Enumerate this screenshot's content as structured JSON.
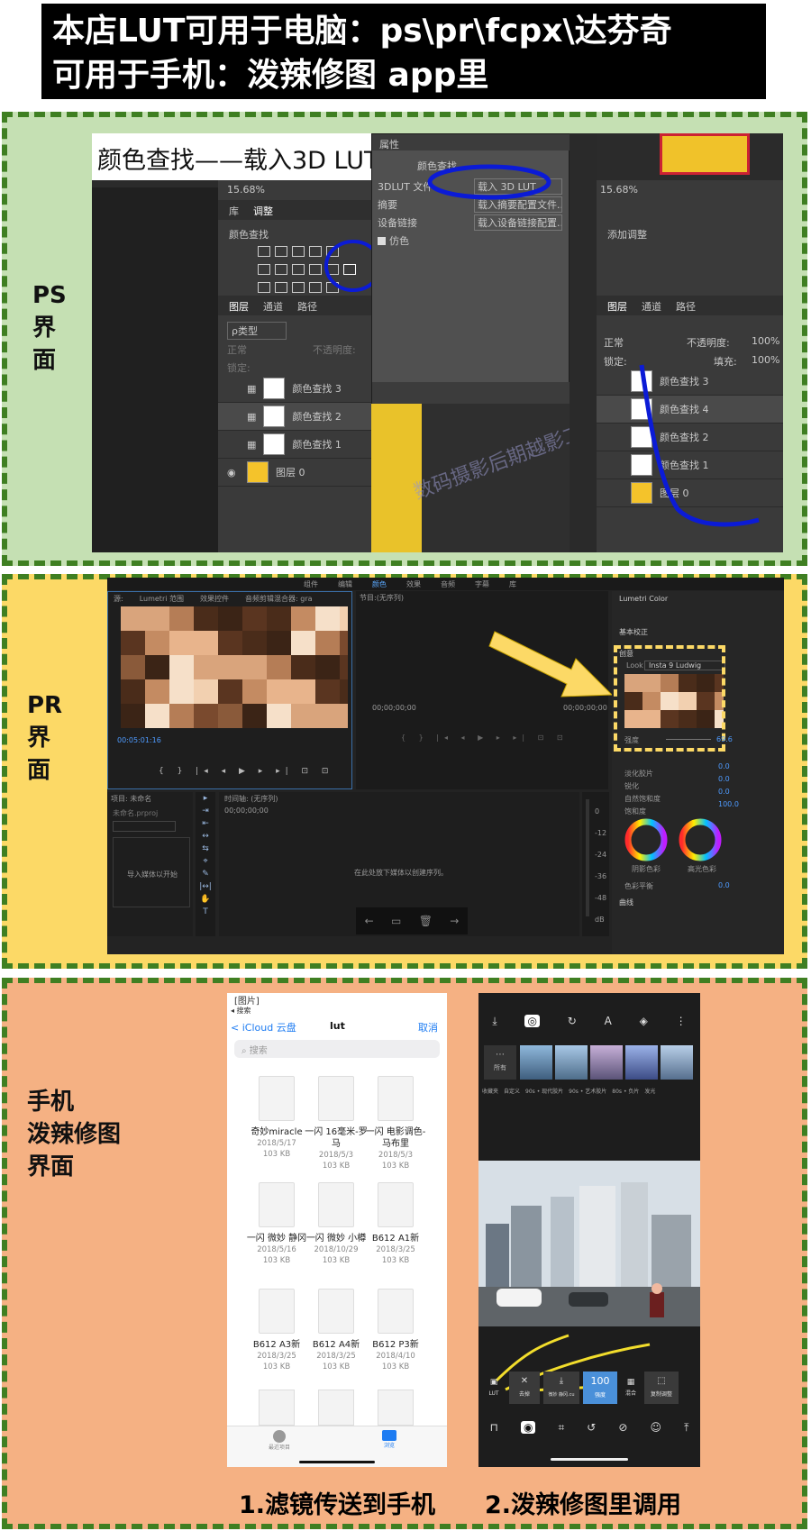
{
  "header": {
    "line1": "本店LUT可用于电脑：ps\\pr\\fcpx\\达芬奇",
    "line2": "可用于手机：泼辣修图 app里"
  },
  "sections": {
    "ps_label": "PS\n界\n面",
    "pr_label": "PR\n界\n面",
    "mobile_label": "手机\n泼辣修图\n界面"
  },
  "ps": {
    "banner": "颜色查找——载入3D LUT",
    "zoom": "15.68%",
    "tabs": [
      "库",
      "调整"
    ],
    "adjust_title": "颜色查找",
    "adjust_title_right": "添加调整",
    "layer_tabs": [
      "图层",
      "通道",
      "路径"
    ],
    "kind": "ρ类型",
    "blend": "正常",
    "opacity_label": "不透明度:",
    "opacity_val": "100%",
    "lock_label": "锁定:",
    "fill_label": "填充:",
    "layers_left": [
      "颜色查找 3",
      "颜色查找 2",
      "颜色查找 1",
      "图层 0"
    ],
    "layers_right": [
      "颜色查找 3",
      "颜色查找 4",
      "颜色查找 2",
      "颜色查找 1",
      "图层 0"
    ],
    "props_title": "属性",
    "props_sub": "颜色查找",
    "options": [
      {
        "label": "3DLUT 文件",
        "value": "载入 3D LUT..."
      },
      {
        "label": "摘要",
        "value": "载入摘要配置文件..."
      },
      {
        "label": "设备链接",
        "value": "载入设备链接配置..."
      }
    ],
    "dither": "仿色",
    "watermark": "数码摄影后期越影工作室"
  },
  "pr": {
    "top_tabs": [
      "组件",
      "编辑",
      "颜色",
      "效果",
      "音频",
      "字幕",
      "库"
    ],
    "source_tabs": [
      "源:",
      "Lumetri 范围",
      "效果控件",
      "音频剪辑混合器: gra"
    ],
    "program": "节目:(无序列)",
    "tc_left": "00;00;00;00",
    "tc_right": "00;00;00;00",
    "source_tc": "00:05:01:16",
    "project": "项目: 未命名",
    "project_file": "未命名.prproj",
    "media_hint": "导入媒体以开始",
    "timeline": "时间轴: (无序列)",
    "timeline_tc": "00;00;00;00",
    "timeline_hint": "在此处放下媒体以创建序列。",
    "lumetri": "Lumetri Color",
    "basic": "基本校正",
    "creative": "创意",
    "look_label": "Look",
    "look": "Insta 9 Ludwig",
    "intensity": "强度",
    "intensity_val": "69.6",
    "sliders": [
      {
        "label": "淡化胶片",
        "val": "0.0"
      },
      {
        "label": "锐化",
        "val": "0.0"
      },
      {
        "label": "自然饱和度",
        "val": "0.0"
      },
      {
        "label": "饱和度",
        "val": "100.0"
      }
    ],
    "wheel_left": "阴影色彩",
    "wheel_right": "高光色彩",
    "balance": "色彩平衡",
    "balance_val": "0.0",
    "curves": "曲线",
    "meter_ticks": [
      "0",
      "-12",
      "-24",
      "-36",
      "-48",
      "dB"
    ],
    "colors": {
      "arrow": "#fcd966",
      "accent": "#2d8ceb"
    }
  },
  "phone_files": {
    "top_tab": "图片",
    "back_hint": "◂ 搜索",
    "back": "iCloud 云盘",
    "title": "lut",
    "cancel": "取消",
    "search": "搜索",
    "files": [
      {
        "name": "奇妙miracle",
        "date": "2018/5/17",
        "size": "103 KB"
      },
      {
        "name": "一闪 16毫米-罗马",
        "date": "2018/5/3",
        "size": "103 KB"
      },
      {
        "name": "一闪 电影调色-马布里",
        "date": "2018/5/3",
        "size": "103 KB"
      },
      {
        "name": "一闪 微妙 静冈",
        "date": "2018/5/16",
        "size": "103 KB"
      },
      {
        "name": "一闪 微妙 小樽",
        "date": "2018/10/29",
        "size": "103 KB"
      },
      {
        "name": "B612 A1新",
        "date": "2018/3/25",
        "size": "103 KB"
      },
      {
        "name": "B612 A3新",
        "date": "2018/3/25",
        "size": "103 KB"
      },
      {
        "name": "B612 A4新",
        "date": "2018/3/25",
        "size": "103 KB"
      },
      {
        "name": "B612 P3新",
        "date": "2018/4/10",
        "size": "103 KB"
      }
    ],
    "tab_recent": "最近项目",
    "tab_browse": "浏览"
  },
  "phone_polarr": {
    "filter_groups": [
      "收藏夹",
      "自定义",
      "90s • 现代胶片",
      "90s • 艺术胶片",
      "80s • 负片",
      "发光"
    ],
    "all": "所有",
    "actions": [
      "LUT",
      "去掉",
      "微妙 静冈.cu",
      "",
      "混合",
      "复制调整"
    ],
    "strength": "100",
    "strength_label": "强度"
  },
  "captions": {
    "left": "1.滤镜传送到手机",
    "right": "2.泼辣修图里调用"
  }
}
